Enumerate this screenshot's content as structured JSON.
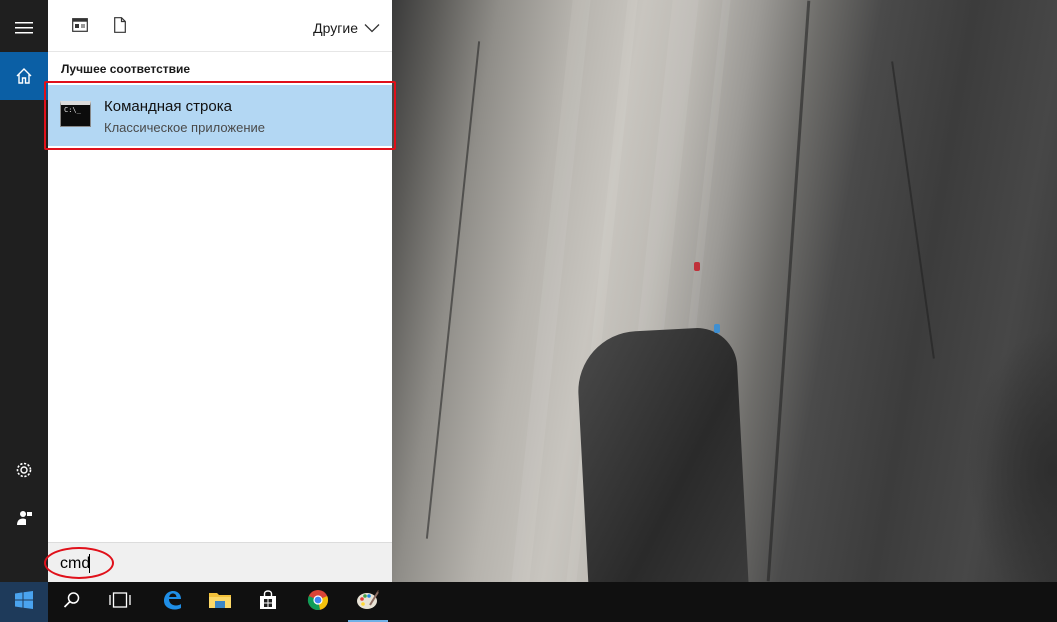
{
  "rail": {
    "items": [
      {
        "icon": "hamburger-menu-icon"
      },
      {
        "icon": "home-icon"
      },
      {
        "icon": "gear-icon"
      },
      {
        "icon": "feedback-icon"
      }
    ]
  },
  "panel": {
    "header": {
      "icons": [
        "apps-filter-icon",
        "documents-filter-icon"
      ],
      "filter_label": "Другие"
    },
    "best_match_heading": "Лучшее соответствие",
    "result": {
      "title": "Командная строка",
      "subtitle": "Классическое приложение",
      "icon_text": "C:\\_"
    }
  },
  "search": {
    "value": "cmd",
    "placeholder": ""
  },
  "taskbar": {
    "items": [
      {
        "icon": "windows-start-icon"
      },
      {
        "icon": "search-icon"
      },
      {
        "icon": "task-view-icon"
      },
      {
        "icon": "edge-browser-icon"
      },
      {
        "icon": "file-explorer-icon"
      },
      {
        "icon": "store-icon"
      },
      {
        "icon": "chrome-icon"
      },
      {
        "icon": "paint-app-icon"
      }
    ]
  },
  "colors": {
    "accent": "#0b5fa5",
    "selection": "#b3d7f3",
    "annotation": "#e0101a",
    "rail_bg": "#1f1f1f",
    "taskbar_bg": "#101010"
  }
}
